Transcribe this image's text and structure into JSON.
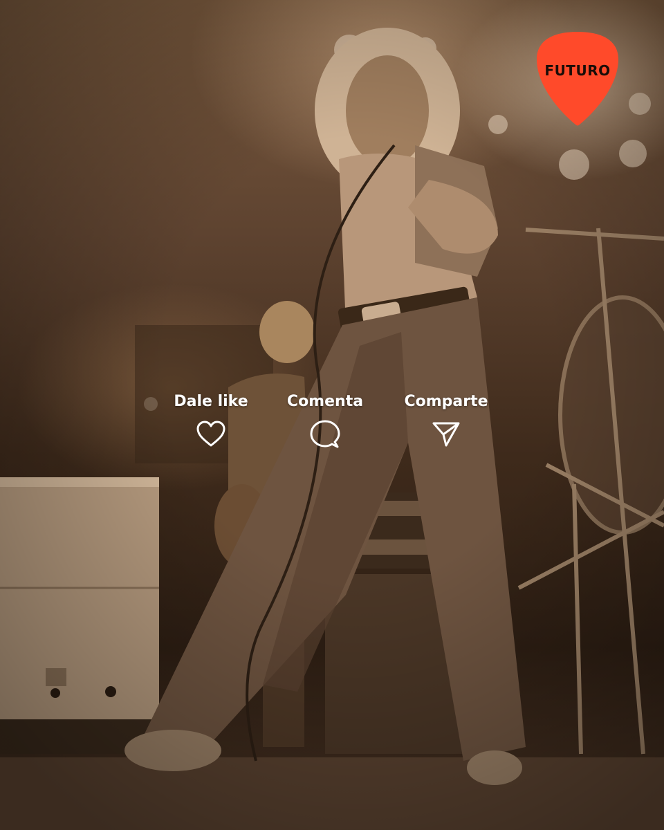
{
  "brand": {
    "logo_text": "FUTURO",
    "logo_color": "#ff4a2a",
    "logo_text_color": "#1a0d08"
  },
  "actions": [
    {
      "label": "Dale like",
      "icon": "heart-icon"
    },
    {
      "label": "Comenta",
      "icon": "comment-icon"
    },
    {
      "label": "Comparte",
      "icon": "send-icon"
    }
  ],
  "theme": {
    "tint": "sepia",
    "overlay_text_color": "#ffffff"
  }
}
